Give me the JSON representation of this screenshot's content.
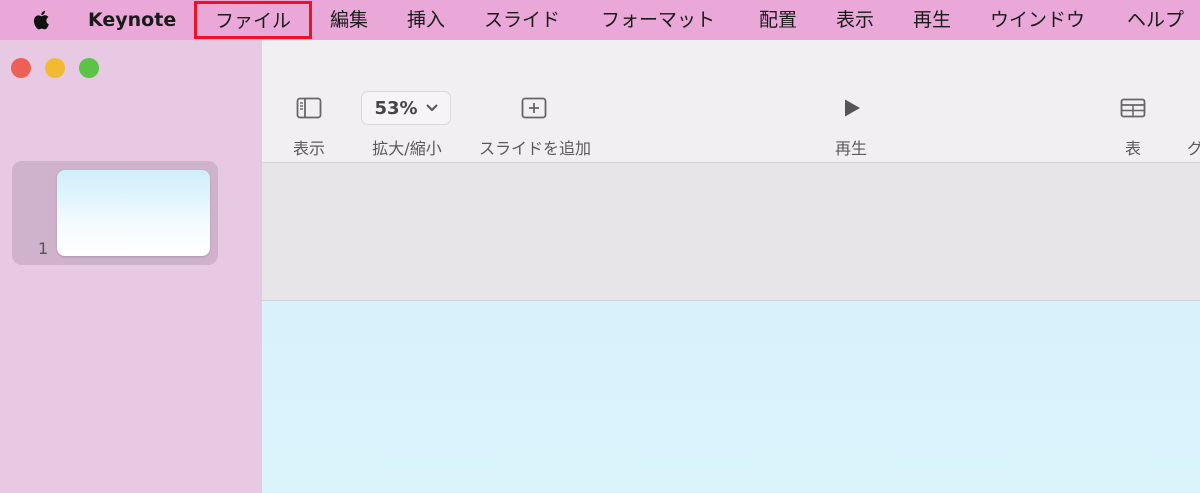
{
  "menubar": {
    "app_name": "Keynote",
    "items": [
      "ファイル",
      "編集",
      "挿入",
      "スライド",
      "フォーマット",
      "配置",
      "表示",
      "再生",
      "ウインドウ",
      "ヘルプ"
    ]
  },
  "toolbar": {
    "view_label": "表示",
    "zoom_value": "53%",
    "zoom_label": "拡大/縮小",
    "add_slide_label": "スライドを追加",
    "play_label": "再生",
    "table_label": "表",
    "cut_label": "グ"
  },
  "slide_navigator": {
    "slide_number": "1"
  },
  "colors": {
    "menubar": "#e9a8d8",
    "highlight": "#e8152a",
    "sidebar": "#e7c9e4",
    "toolbar": "#f2eff3",
    "slide_background": "#d8f1fb"
  }
}
